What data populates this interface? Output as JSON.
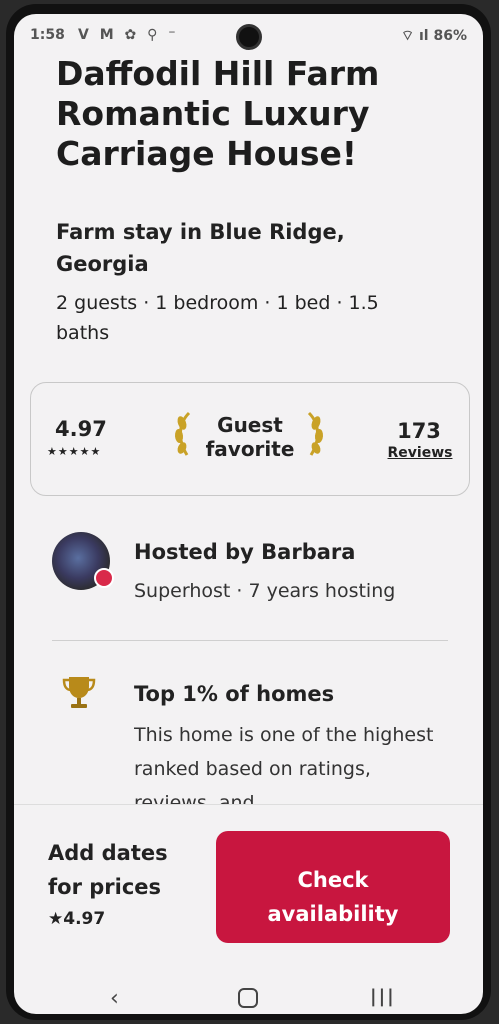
{
  "status_bar": {
    "time": "1:58",
    "left_icons": "V M ✿ ⚲ ⁻",
    "battery": "86%",
    "right_icons": "⌔ ıl"
  },
  "listing": {
    "title_lines": [
      "Daffodil Hill Farm",
      "Romantic Luxury",
      "Carriage House!"
    ],
    "subtitle_lines": [
      "Farm stay in Blue Ridge,",
      "Georgia"
    ],
    "details_lines": [
      "2 guests · 1 bedroom · 1 bed · 1.5",
      "baths"
    ]
  },
  "rating_card": {
    "rating": "4.97",
    "stars": "★★★★★",
    "badge_lines": [
      "Guest",
      "favorite"
    ],
    "reviews_count": "173",
    "reviews_label": "Reviews"
  },
  "host": {
    "name_label": "Hosted by Barbara",
    "meta": "Superhost · 7 years hosting"
  },
  "highlight": {
    "title": "Top 1% of homes",
    "description": "This home is one of the highest ranked based on ratings, reviews, and"
  },
  "bottom_bar": {
    "price_lines": [
      "Add dates",
      "for prices"
    ],
    "rating": "★4.97",
    "check_lines": [
      "Check",
      "availability"
    ]
  },
  "nav_bar": {
    "back": "‹",
    "recent": "|||"
  },
  "colors": {
    "accent": "#c8163f",
    "text": "#222222",
    "background": "#f3f2f3"
  }
}
